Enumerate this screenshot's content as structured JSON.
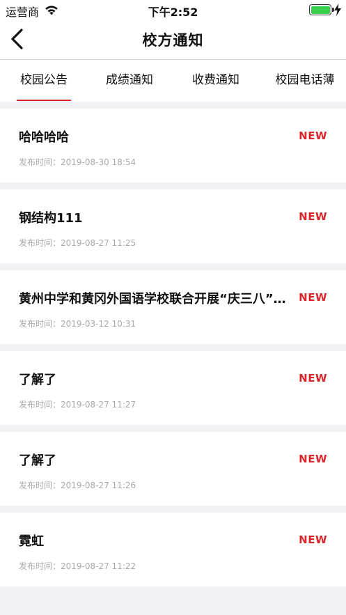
{
  "status_bar": {
    "carrier": "运营商",
    "time": "下午2:52"
  },
  "nav": {
    "title": "校方通知"
  },
  "tabs": [
    {
      "label": "校园公告",
      "active": true
    },
    {
      "label": "成绩通知",
      "active": false
    },
    {
      "label": "收费通知",
      "active": false
    },
    {
      "label": "校园电话薄",
      "active": false
    }
  ],
  "colors": {
    "accent": "#d9262a",
    "battery": "#3bd14c",
    "background": "#f2f2f6"
  },
  "notices": [
    {
      "title": "哈哈哈哈",
      "badge": "NEW",
      "time": "发布时间：2019-08-30 18:54"
    },
    {
      "title": "钢结构111",
      "badge": "NEW",
      "time": "发布时间：2019-08-27 11:25"
    },
    {
      "title": "黄州中学和黄冈外国语学校联合开展“庆三八”活动",
      "badge": "NEW",
      "time": "发布时间：2019-03-12 10:31"
    },
    {
      "title": "了解了",
      "badge": "NEW",
      "time": "发布时间：2019-08-27 11:27"
    },
    {
      "title": "了解了",
      "badge": "NEW",
      "time": "发布时间：2019-08-27 11:26"
    },
    {
      "title": "霓虹",
      "badge": "NEW",
      "time": "发布时间：2019-08-27 11:22"
    }
  ]
}
